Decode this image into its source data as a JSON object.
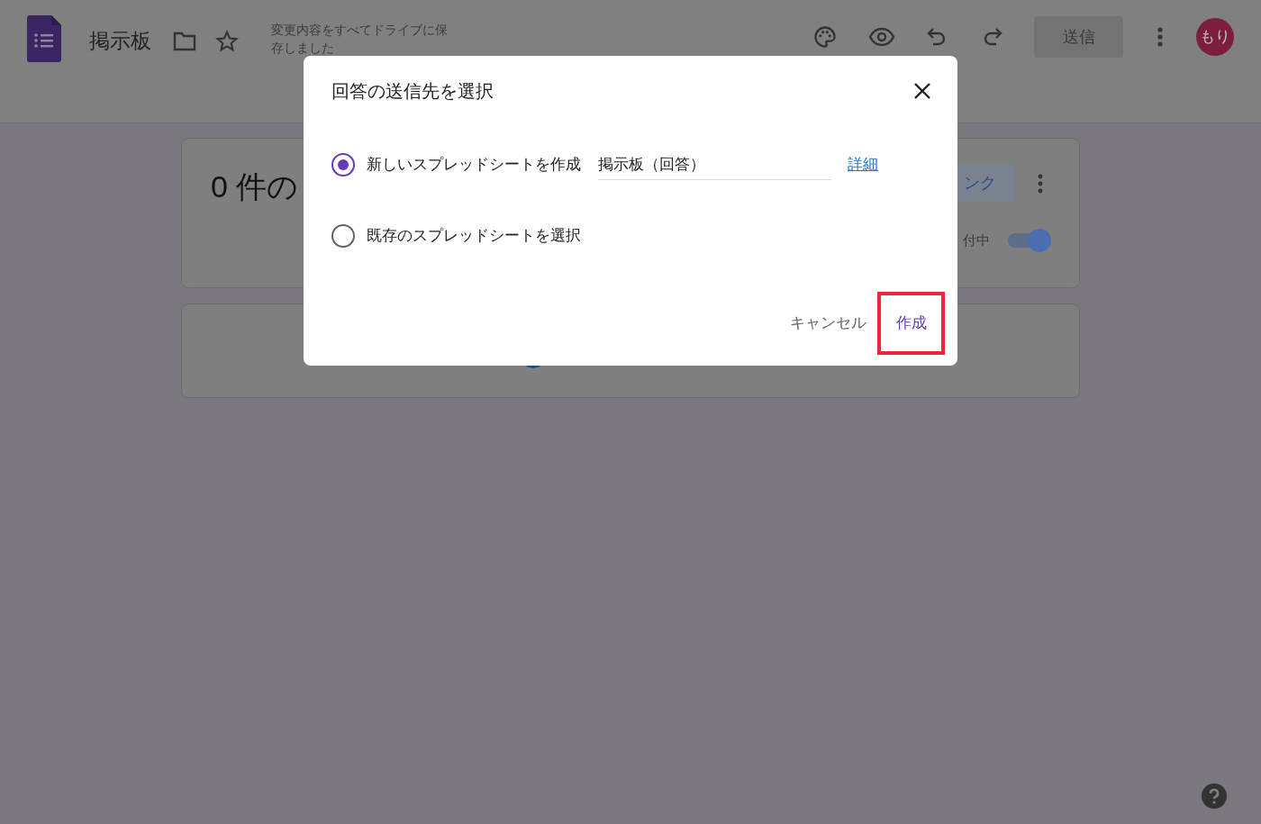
{
  "header": {
    "title": "掲示板",
    "save_status": "変更内容をすべてドライブに保存しました",
    "send_button": {
      "label": "送信",
      "disabled": true
    },
    "avatar": "もり"
  },
  "summary_card": {
    "heading": "0 件の",
    "link_tab": "ンク",
    "accepting_label": "付中",
    "accepting": {
      "on": true
    }
  },
  "dialog": {
    "title": "回答の送信先を選択",
    "options": [
      {
        "label": "新しいスプレッドシートを作成",
        "selected": true
      },
      {
        "label": "既存のスプレッドシートを選択",
        "selected": false
      }
    ],
    "name_field": {
      "value": "掲示板（回答）"
    },
    "details_link": "詳細",
    "buttons": [
      {
        "label": "キャンセル",
        "kind": "text",
        "highlighted": false
      },
      {
        "label": "作成",
        "kind": "primary",
        "highlighted": true
      }
    ]
  }
}
